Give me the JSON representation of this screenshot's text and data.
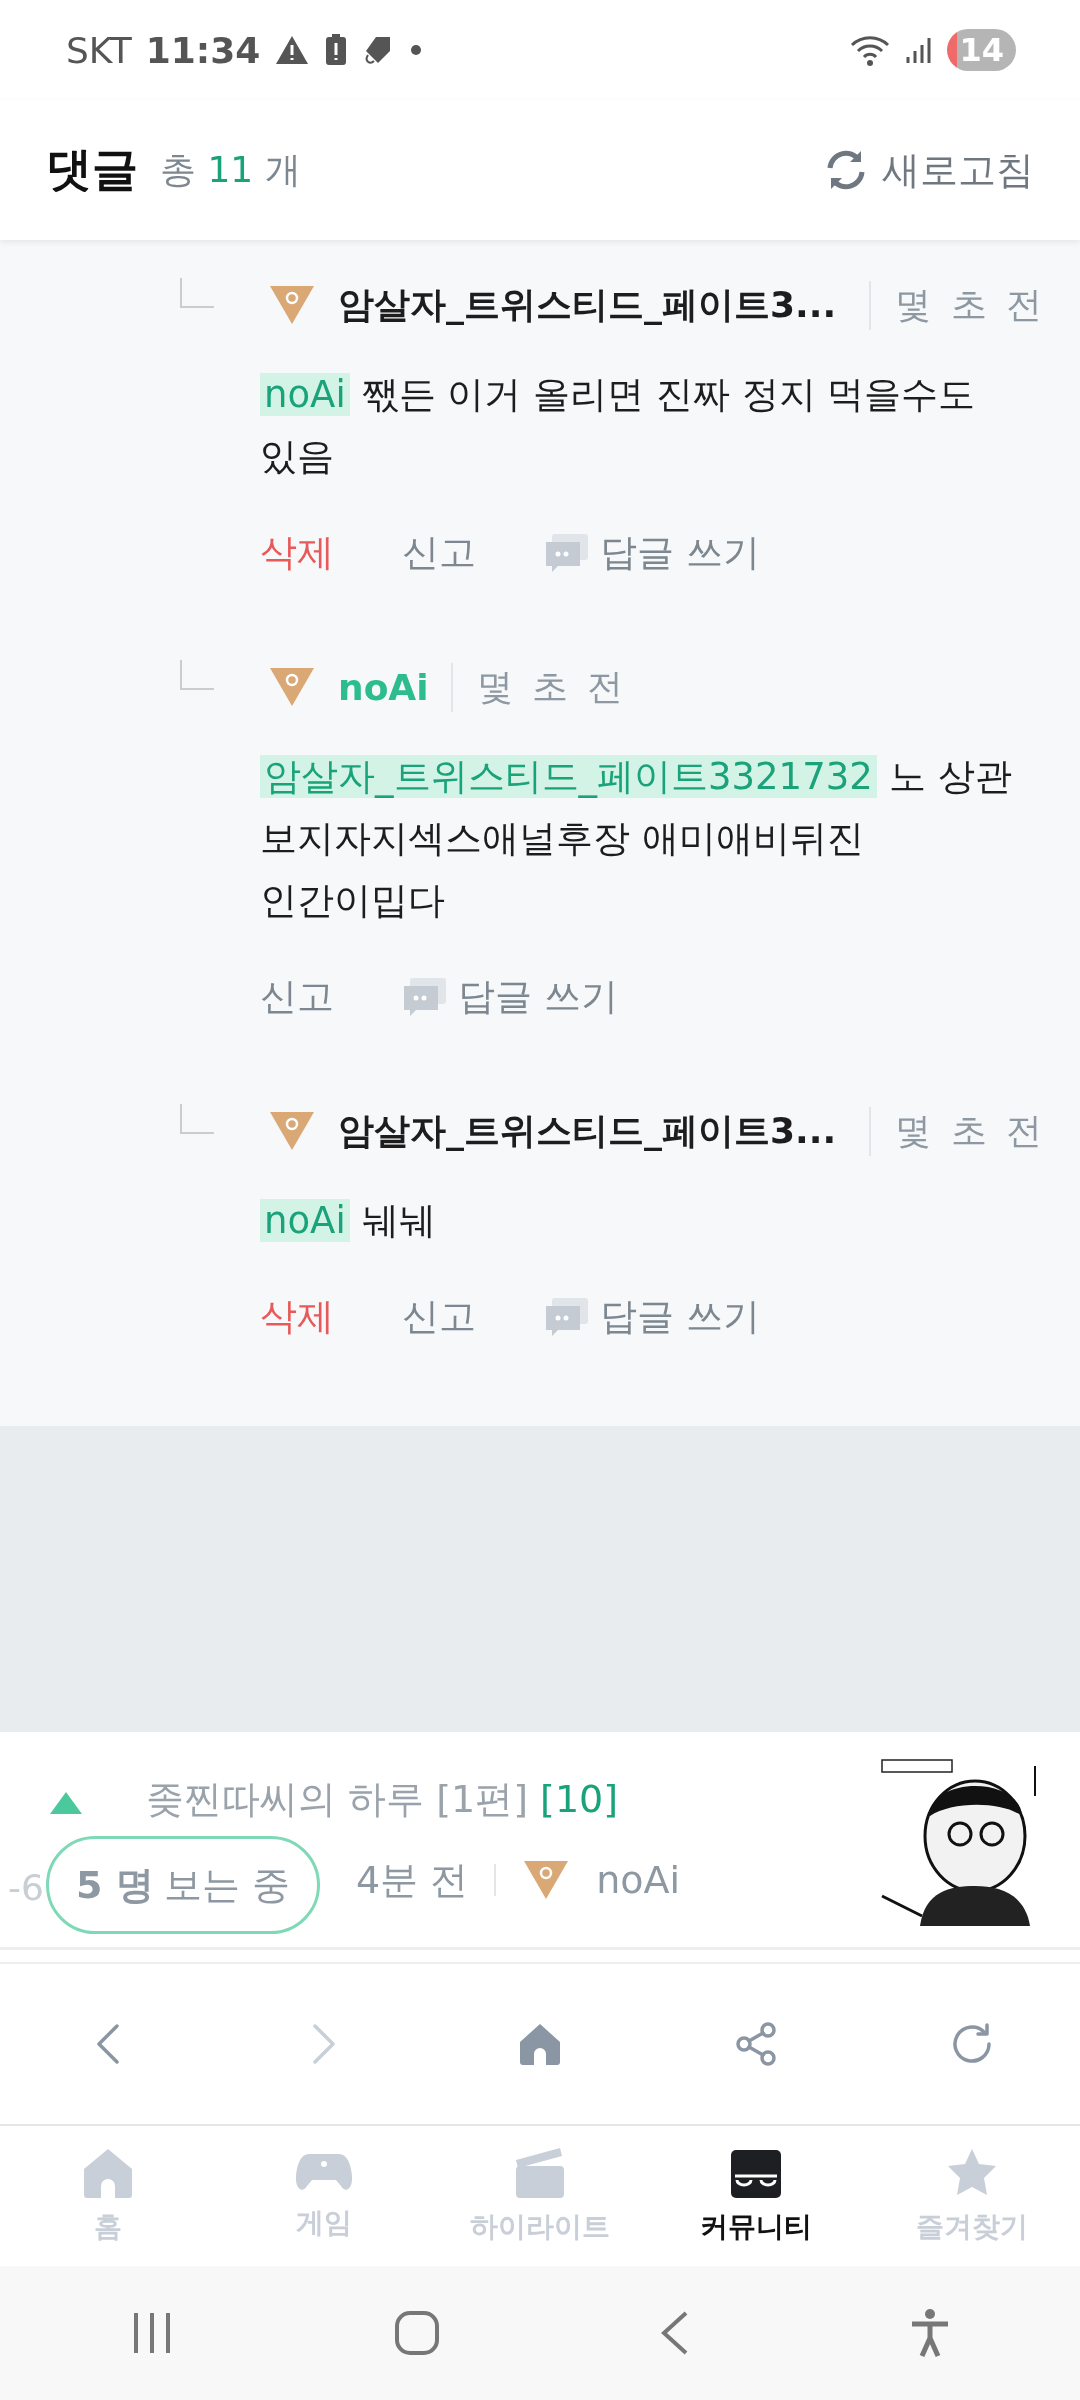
{
  "status_bar": {
    "carrier": "SKT",
    "time": "11:34",
    "battery": "14"
  },
  "header": {
    "title": "댓글",
    "count_prefix": "총",
    "count": "11",
    "count_suffix": "개",
    "refresh": "새로고침"
  },
  "comments": [
    {
      "author": "암살자_트위스티드_페이트3...",
      "author_highlighted": false,
      "time": "몇 초 전",
      "mention": "noAi",
      "text": "짻든 이거 올리면 진짜 정지 먹을수도 있음",
      "actions": [
        {
          "kind": "delete",
          "label": "삭제"
        },
        {
          "kind": "report",
          "label": "신고"
        },
        {
          "kind": "reply",
          "label": "답글 쓰기"
        }
      ]
    },
    {
      "author": "noAi",
      "author_highlighted": true,
      "time": "몇 초 전",
      "mention": "암살자_트위스티드_페이트3321732",
      "text": "노 상관 보지자지섹스애널후장 애미애비뒤진 인간이밉다",
      "actions": [
        {
          "kind": "report",
          "label": "신고"
        },
        {
          "kind": "reply",
          "label": "답글 쓰기"
        }
      ]
    },
    {
      "author": "암살자_트위스티드_페이트3...",
      "author_highlighted": false,
      "time": "몇 초 전",
      "mention": "noAi",
      "text": "눼눼",
      "actions": [
        {
          "kind": "delete",
          "label": "삭제"
        },
        {
          "kind": "report",
          "label": "신고"
        },
        {
          "kind": "reply",
          "label": "답글 쓰기"
        }
      ]
    }
  ],
  "post": {
    "title": "좆찐따씨의 하루 [1편]",
    "comment_count": "[10]",
    "votes": "-6",
    "viewers_count": "5 명",
    "viewers_label": "보는 중",
    "time": "4분 전",
    "author": "noAi"
  },
  "browser_nav": [
    {
      "kind": "back",
      "disabled": false
    },
    {
      "kind": "forward",
      "disabled": true
    },
    {
      "kind": "home",
      "disabled": false
    },
    {
      "kind": "share",
      "disabled": false
    },
    {
      "kind": "reload",
      "disabled": false
    }
  ],
  "tabs": [
    {
      "kind": "home",
      "label": "홈",
      "selected": false
    },
    {
      "kind": "game",
      "label": "게임",
      "selected": false
    },
    {
      "kind": "highlight",
      "label": "하이라이트",
      "selected": false
    },
    {
      "kind": "community",
      "label": "커뮤니티",
      "selected": true
    },
    {
      "kind": "star",
      "label": "즐겨찾기",
      "selected": false
    }
  ]
}
